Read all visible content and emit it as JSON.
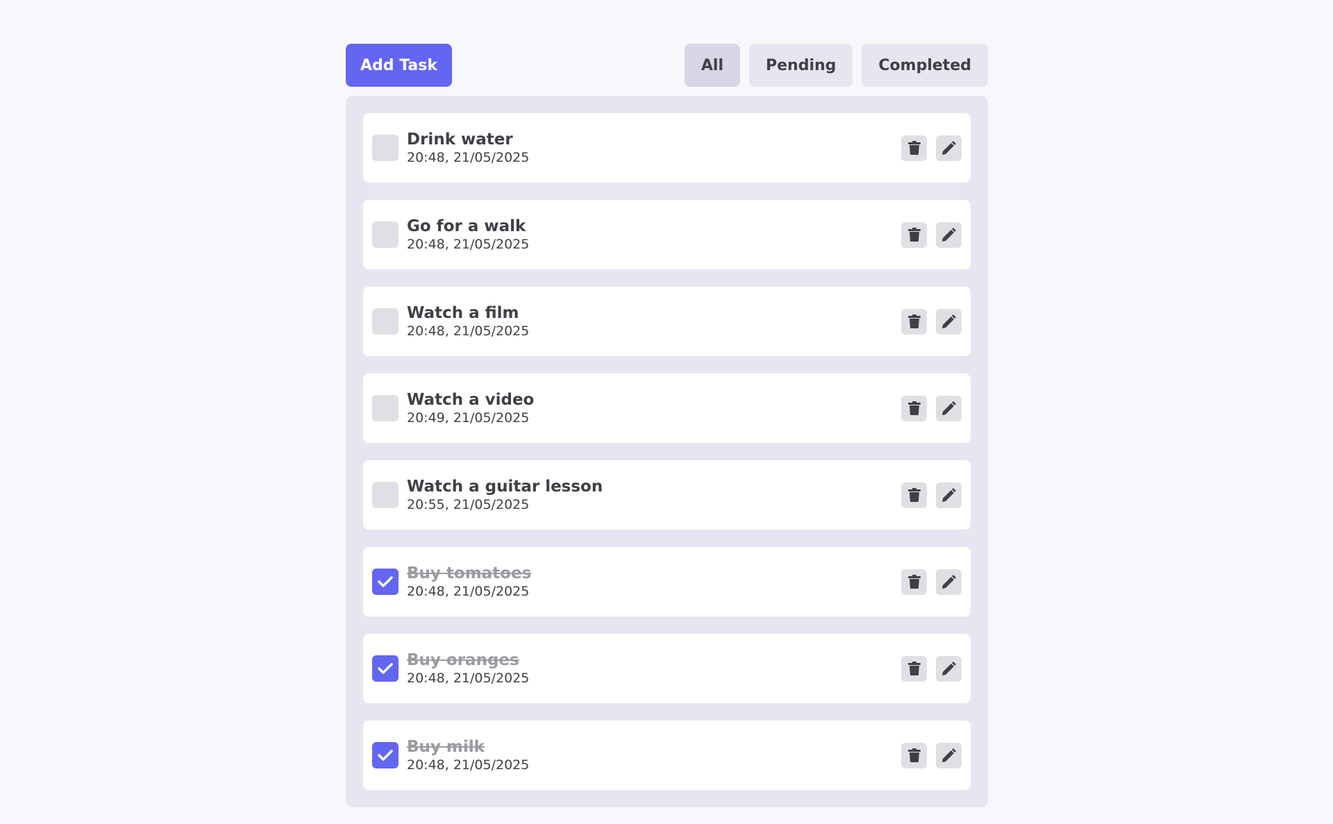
{
  "toolbar": {
    "add_label": "Add Task",
    "filters": [
      {
        "label": "All",
        "active": true
      },
      {
        "label": "Pending",
        "active": false
      },
      {
        "label": "Completed",
        "active": false
      }
    ]
  },
  "colors": {
    "accent": "#6366f1",
    "page_bg": "#f7f8fc",
    "panel_bg": "#e6e6f1",
    "card_bg": "#ffffff",
    "control_bg": "#e0e0e4",
    "text": "#3f3f46",
    "done_text": "#9a9aa0"
  },
  "icons": {
    "delete": "trash-icon",
    "edit": "pencil-icon",
    "check": "check-icon"
  },
  "tasks": [
    {
      "title": "Drink water",
      "time": "20:48, 21/05/2025",
      "completed": false
    },
    {
      "title": "Go for a walk",
      "time": "20:48, 21/05/2025",
      "completed": false
    },
    {
      "title": "Watch a film",
      "time": "20:48, 21/05/2025",
      "completed": false
    },
    {
      "title": "Watch a video",
      "time": "20:49, 21/05/2025",
      "completed": false
    },
    {
      "title": "Watch a guitar lesson",
      "time": "20:55, 21/05/2025",
      "completed": false
    },
    {
      "title": "Buy tomatoes",
      "time": "20:48, 21/05/2025",
      "completed": true
    },
    {
      "title": "Buy oranges",
      "time": "20:48, 21/05/2025",
      "completed": true
    },
    {
      "title": "Buy milk",
      "time": "20:48, 21/05/2025",
      "completed": true
    }
  ]
}
